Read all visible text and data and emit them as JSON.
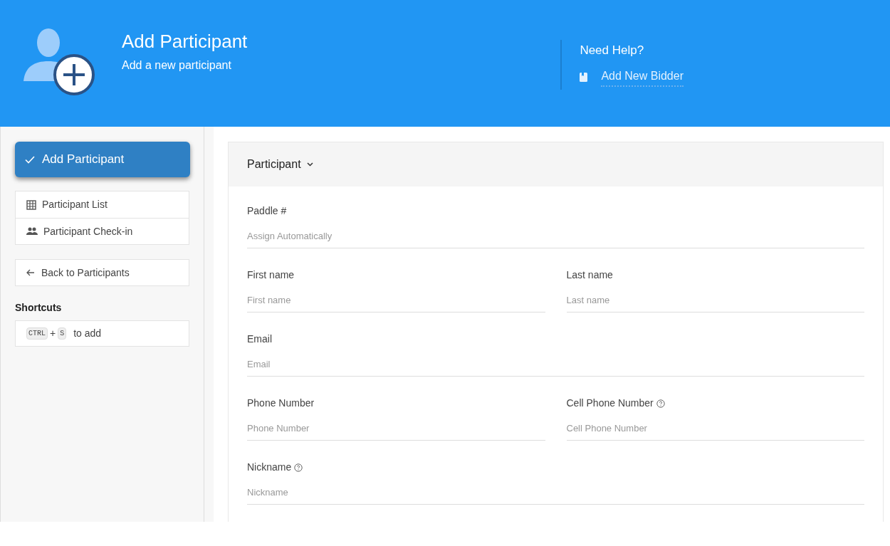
{
  "header": {
    "title": "Add Participant",
    "subtitle": "Add a new participant",
    "help_title": "Need Help?",
    "help_link": "Add New Bidder"
  },
  "sidebar": {
    "primary_button": "Add Participant",
    "nav": [
      {
        "kind": "grid",
        "label": "Participant List"
      },
      {
        "kind": "people",
        "label": "Participant Check-in"
      }
    ],
    "back": "Back to Participants",
    "shortcuts_title": "Shortcuts",
    "shortcut": {
      "keys": [
        "CTRL",
        "S"
      ],
      "joiner": "+",
      "text": "to add"
    }
  },
  "form": {
    "section": "Participant",
    "expanded": true,
    "rows": [
      [
        {
          "label": "Paddle #",
          "placeholder": "Assign Automatically",
          "help": false
        }
      ],
      [
        {
          "label": "First name",
          "placeholder": "First name",
          "help": false
        },
        {
          "label": "Last name",
          "placeholder": "Last name",
          "help": false
        }
      ],
      [
        {
          "label": "Email",
          "placeholder": "Email",
          "help": false
        }
      ],
      [
        {
          "label": "Phone Number",
          "placeholder": "Phone Number",
          "help": false
        },
        {
          "label": "Cell Phone Number",
          "placeholder": "Cell Phone Number",
          "help": true
        }
      ],
      [
        {
          "label": "Nickname",
          "placeholder": "Nickname",
          "help": true
        }
      ]
    ]
  }
}
